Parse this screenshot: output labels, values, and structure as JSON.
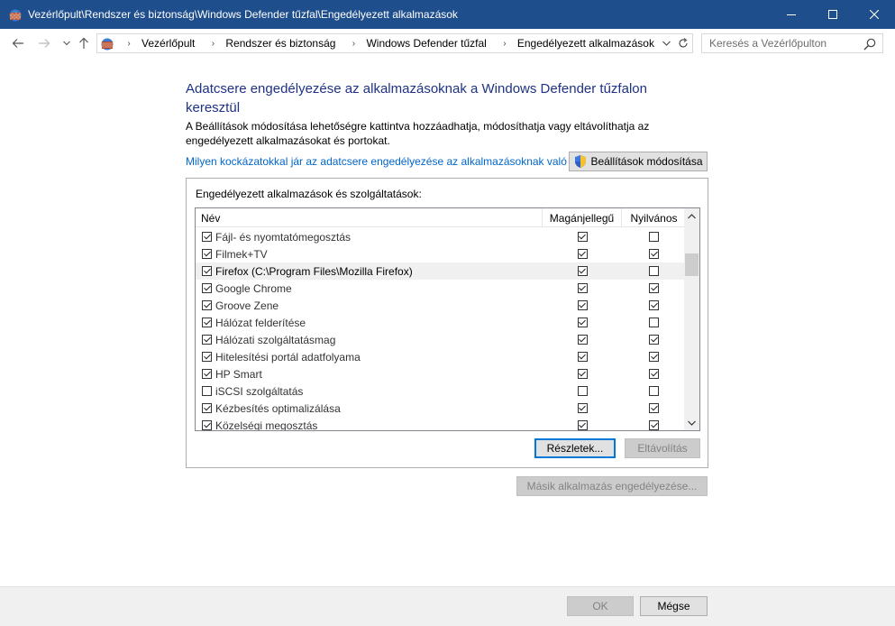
{
  "window": {
    "title": "Vezérlőpult\\Rendszer és biztonság\\Windows Defender tűzfal\\Engedélyezett alkalmazások"
  },
  "address": {
    "crumbs": [
      "Vezérlőpult",
      "Rendszer és biztonság",
      "Windows Defender tűzfal",
      "Engedélyezett alkalmazások"
    ]
  },
  "search": {
    "placeholder": "Keresés a Vezérlőpulton"
  },
  "main": {
    "heading": "Adatcsere engedélyezése az alkalmazásoknak a Windows Defender tűzfalon keresztül",
    "description": "A Beállítások módosítása lehetőségre kattintva hozzáadhatja, módosíthatja vagy eltávolíthatja az engedélyezett alkalmazásokat és portokat.",
    "risk_link": "Milyen kockázatokkal jár az adatcsere engedélyezése az alkalmazásoknak való engedélyezése?",
    "change_settings_label": "Beállítások módosítása",
    "group_label": "Engedélyezett alkalmazások és szolgáltatások:",
    "columns": {
      "name": "Név",
      "private": "Magánjellegű",
      "public": "Nyilvános"
    },
    "rows": [
      {
        "name": "Fájl- és nyomtatómegosztás",
        "enabled": true,
        "private": true,
        "public": false
      },
      {
        "name": "Filmek+TV",
        "enabled": true,
        "private": true,
        "public": true
      },
      {
        "name": "Firefox (C:\\Program Files\\Mozilla Firefox)",
        "enabled": true,
        "private": true,
        "public": false
      },
      {
        "name": "Google Chrome",
        "enabled": true,
        "private": true,
        "public": true
      },
      {
        "name": "Groove Zene",
        "enabled": true,
        "private": true,
        "public": true
      },
      {
        "name": "Hálózat felderítése",
        "enabled": true,
        "private": true,
        "public": false
      },
      {
        "name": "Hálózati szolgáltatásmag",
        "enabled": true,
        "private": true,
        "public": true
      },
      {
        "name": "Hitelesítési portál adatfolyama",
        "enabled": true,
        "private": true,
        "public": true
      },
      {
        "name": "HP Smart",
        "enabled": true,
        "private": true,
        "public": true
      },
      {
        "name": "iSCSI szolgáltatás",
        "enabled": false,
        "private": false,
        "public": false
      },
      {
        "name": "Kézbesítés optimalizálása",
        "enabled": true,
        "private": true,
        "public": true
      },
      {
        "name": "Közelségi megosztás",
        "enabled": true,
        "private": true,
        "public": true
      }
    ],
    "details_label": "Részletek...",
    "remove_label": "Eltávolítás",
    "allow_other_label": "Másik alkalmazás engedélyezése..."
  },
  "footer": {
    "ok_label": "OK",
    "cancel_label": "Mégse"
  },
  "colors": {
    "titlebar": "#1f4e8c",
    "heading": "#1e3287",
    "link": "#0066cc",
    "default_button_border": "#0078d7"
  }
}
